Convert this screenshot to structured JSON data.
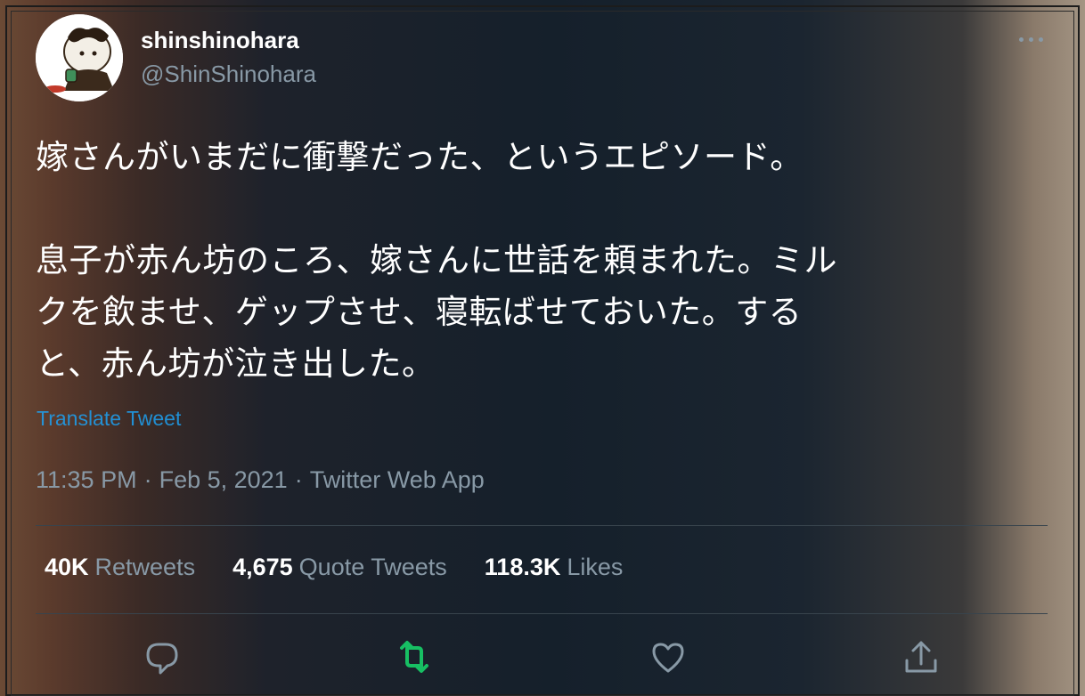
{
  "author": {
    "display_name": "shinshinohara",
    "handle": "@ShinShinohara"
  },
  "tweet": {
    "text": "嫁さんがいまだに衝撃だった、というエピソード。\n\n息子が赤ん坊のころ、嫁さんに世話を頼まれた。ミル\nクを飲ませ、ゲップさせ、寝転ばせておいた。する\nと、赤ん坊が泣き出した。",
    "translate_label": "Translate Tweet",
    "time": "11:35 PM",
    "date": "Feb 5, 2021",
    "source": "Twitter Web App",
    "separator": "·"
  },
  "stats": {
    "retweets_count": "40K",
    "retweets_label": "Retweets",
    "quotes_count": "4,675",
    "quotes_label": "Quote Tweets",
    "likes_count": "118.3K",
    "likes_label": "Likes"
  },
  "icons": {
    "more": "more-icon",
    "reply": "reply-icon",
    "retweet": "retweet-icon",
    "like": "like-icon",
    "share": "share-icon"
  },
  "colors": {
    "background": "#15202b",
    "muted_text": "#8899a6",
    "link": "#1da1f2",
    "retweet_green": "#17bf63",
    "divider": "#38444d"
  }
}
